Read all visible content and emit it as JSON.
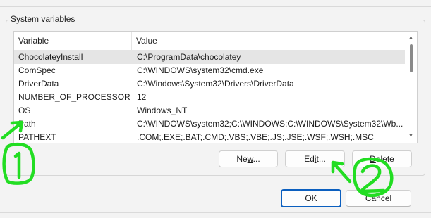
{
  "groupbox": {
    "title_underlined": "S",
    "title_rest": "ystem variables"
  },
  "table": {
    "headers": {
      "variable": "Variable",
      "value": "Value"
    },
    "rows": [
      {
        "variable": "ChocolateyInstall",
        "value": "C:\\ProgramData\\chocolatey"
      },
      {
        "variable": "ComSpec",
        "value": "C:\\WINDOWS\\system32\\cmd.exe"
      },
      {
        "variable": "DriverData",
        "value": "C:\\Windows\\System32\\Drivers\\DriverData"
      },
      {
        "variable": "NUMBER_OF_PROCESSORS",
        "value": "12"
      },
      {
        "variable": "OS",
        "value": "Windows_NT"
      },
      {
        "variable": "Path",
        "value": "C:\\WINDOWS\\system32;C:\\WINDOWS;C:\\WINDOWS\\System32\\Wb..."
      },
      {
        "variable": "PATHEXT",
        "value": ".COM;.EXE;.BAT;.CMD;.VBS;.VBE;.JS;.JSE;.WSF;.WSH;.MSC"
      }
    ]
  },
  "buttons": {
    "new_underlined": "w",
    "new_before": "Ne",
    "new_after": "...",
    "edit_before": "Ed",
    "edit_underlined": "i",
    "edit_after": "t...",
    "delete_underlined": "D",
    "delete_after": "elete",
    "ok": "OK",
    "cancel": "Cancel"
  },
  "annotations": {
    "label_1": "1",
    "label_2": "2",
    "color": "#22dd22"
  }
}
